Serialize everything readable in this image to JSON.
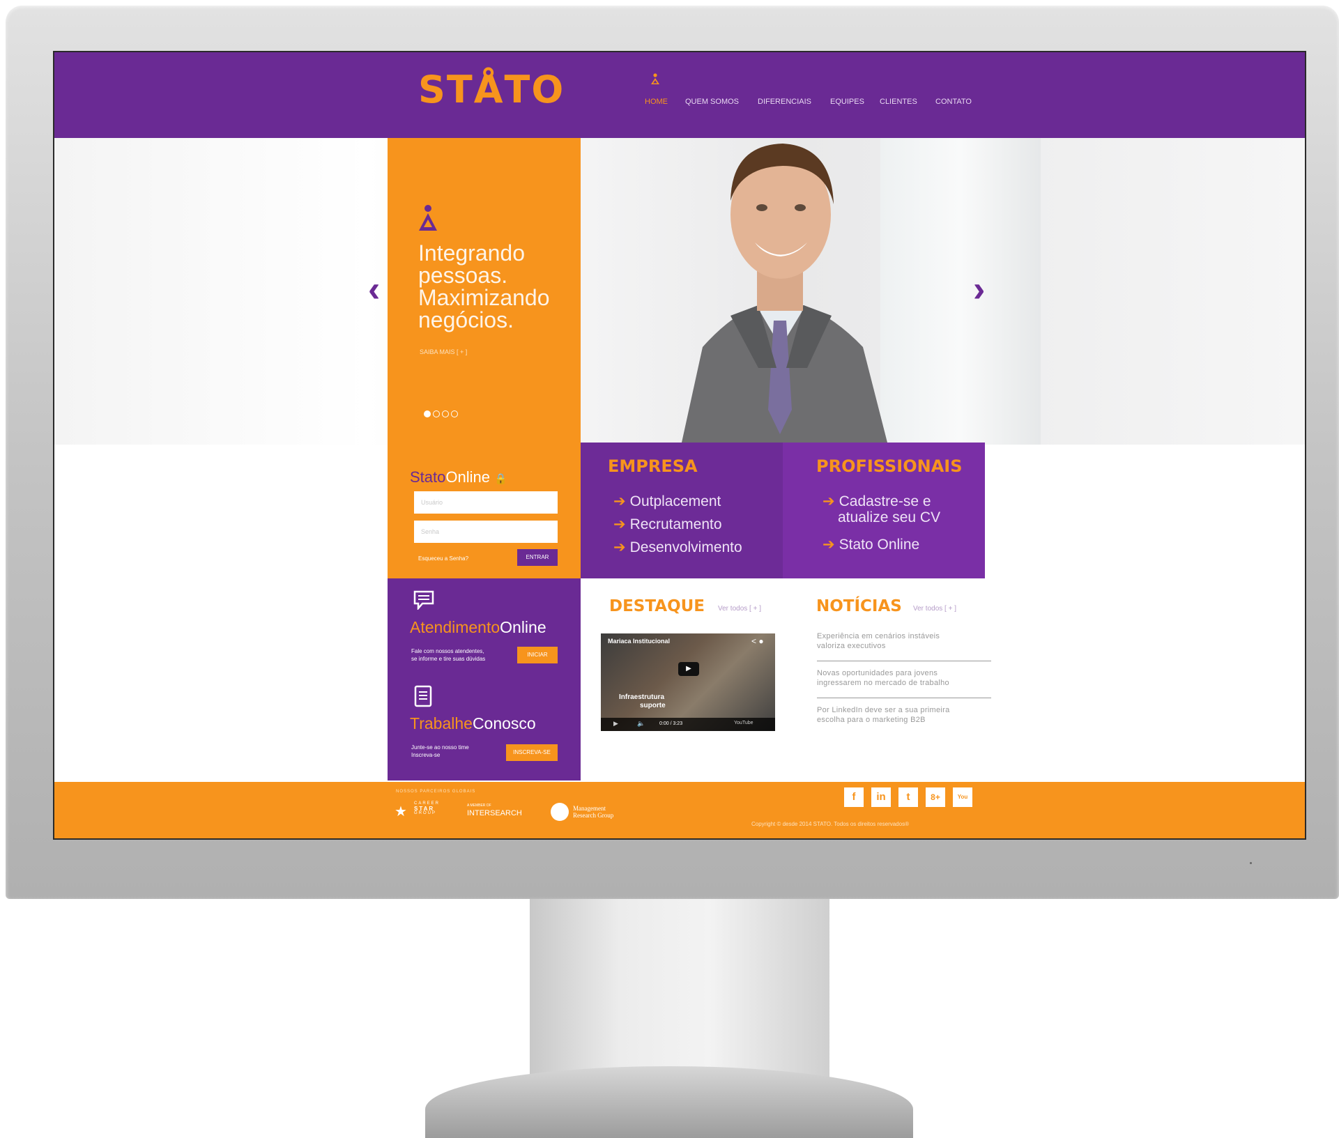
{
  "site": {
    "logo": "STÅTO",
    "nav": [
      "HOME",
      "QUEM SOMOS",
      "DIFERENCIAIS",
      "EQUIPES",
      "CLIENTES",
      "CONTATO"
    ]
  },
  "hero": {
    "tagline_lines": [
      "Integrando",
      "pessoas.",
      "Maximizando",
      "negócios."
    ],
    "saiba_mais": "SAIBA MAIS [ + ]",
    "arrow_left": "‹",
    "arrow_right": "›"
  },
  "login": {
    "title_part1": "Stato",
    "title_part2": "Online",
    "lock_icon": "🔒",
    "user_placeholder": "Usuário",
    "pass_placeholder": "Senha",
    "forgot": "Esqueceu a Senha?",
    "enter": "ENTRAR"
  },
  "empresa": {
    "title": "EMPRESA",
    "items": [
      "Outplacement",
      "Recrutamento",
      "Desenvolvimento"
    ]
  },
  "profissionais": {
    "title": "PROFISSIONAIS",
    "items": [
      "Cadastre-se e",
      "atualize seu CV",
      "Stato Online"
    ]
  },
  "atendimento": {
    "title_part1": "Atendimento",
    "title_part2": "Online",
    "text_line1": "Fale com nossos atendentes,",
    "text_line2": "se informe e tire suas dúvidas",
    "button": "INICIAR"
  },
  "trabalhe": {
    "title_part1": "Trabalhe",
    "title_part2": "Conosco",
    "text_line1": "Junte-se ao nosso time",
    "text_line2": "Inscreva-se",
    "button": "INSCREVA-SE"
  },
  "destaque": {
    "title": "DESTAQUE",
    "more": "Ver todos [ + ]",
    "video_title": "Mariaca Institucional",
    "video_overlay": "Infraestrutura",
    "video_overlay2": "suporte",
    "video_time": "0:00 / 3:23",
    "video_brand": "YouTube"
  },
  "noticias": {
    "title": "NOTÍCIAS",
    "more": "Ver todos [ + ]",
    "items": [
      [
        "Experiência em cenários instáveis",
        "valoriza executivos"
      ],
      [
        "Novas oportunidades para jovens",
        "ingressarem no mercado de trabalho"
      ],
      [
        "Por LinkedIn deve ser a sua primeira",
        "escolha para o marketing B2B"
      ]
    ]
  },
  "footer": {
    "partners_label": "NOSSOS PARCEIROS GLOBAIS",
    "partner1_line1": "CAREER",
    "partner1_line2": "STAR",
    "partner1_line3": "GROUP",
    "partner2_small": "A MEMBER OF",
    "partner2": "INTERSEARCH",
    "partner3_line1": "Management",
    "partner3_line2": "Research Group",
    "social": [
      "f",
      "in",
      "t",
      "8+",
      "You"
    ],
    "copyright": "Copyright © desde 2014 STATO. Todos os direitos reservados®"
  },
  "colors": {
    "purple": "#6a2a94",
    "orange": "#f7941d"
  }
}
